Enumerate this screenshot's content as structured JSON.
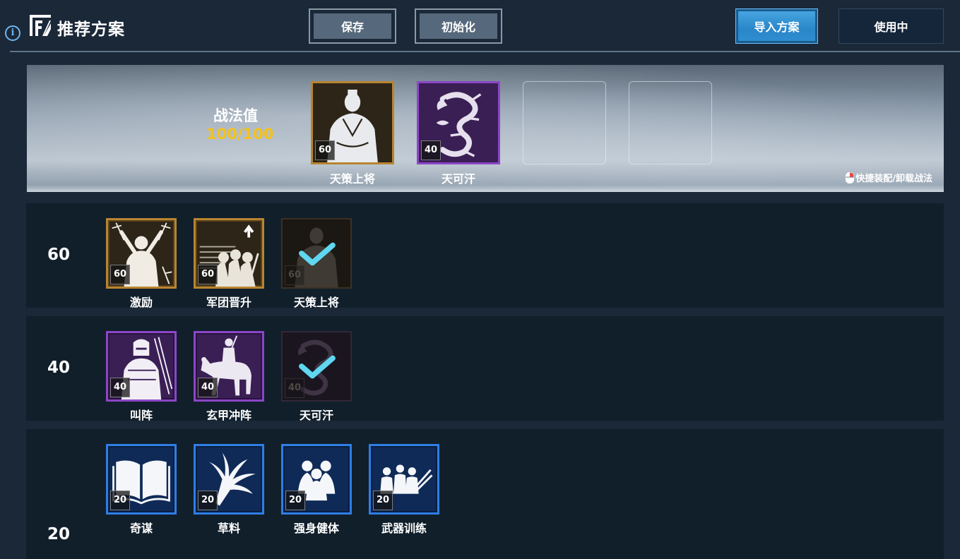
{
  "header": {
    "title": "推荐方案",
    "save_label": "保存",
    "reset_label": "初始化",
    "import_label": "导入方案",
    "in_use_label": "使用中"
  },
  "banner": {
    "points_label": "战法值",
    "points_value": "100/100",
    "equipped": [
      {
        "name": "天策上将",
        "level": "60",
        "tier": "gold"
      },
      {
        "name": "天可汗",
        "level": "40",
        "tier": "purple"
      }
    ],
    "empty_slots": 2,
    "hint": "快捷装配/卸载战法"
  },
  "rows": [
    {
      "level": "60",
      "cards": [
        {
          "name": "激励",
          "badge": "60",
          "tier": "gold",
          "icon": "rallying-warrior-icon",
          "selected": false
        },
        {
          "name": "军团晋升",
          "badge": "60",
          "tier": "gold",
          "icon": "legion-promotion-icon",
          "selected": false
        },
        {
          "name": "天策上将",
          "badge": "60",
          "tier": "gold",
          "icon": "general-portrait-icon",
          "selected": true
        }
      ]
    },
    {
      "level": "40",
      "cards": [
        {
          "name": "叫阵",
          "badge": "40",
          "tier": "purple",
          "icon": "challenger-warrior-icon",
          "selected": false
        },
        {
          "name": "玄甲冲阵",
          "badge": "40",
          "tier": "purple",
          "icon": "armored-cavalry-icon",
          "selected": false
        },
        {
          "name": "天可汗",
          "badge": "40",
          "tier": "purple",
          "icon": "dragon-icon",
          "selected": true
        }
      ]
    },
    {
      "level": "20",
      "cards": [
        {
          "name": "奇谋",
          "badge": "20",
          "tier": "blue",
          "icon": "open-book-icon",
          "selected": false
        },
        {
          "name": "草料",
          "badge": "20",
          "tier": "blue",
          "icon": "fodder-sheaf-icon",
          "selected": false
        },
        {
          "name": "强身健体",
          "badge": "20",
          "tier": "blue",
          "icon": "soldiers-fitness-icon",
          "selected": false
        },
        {
          "name": "武器训练",
          "badge": "20",
          "tier": "blue",
          "icon": "weapon-training-icon",
          "selected": false
        }
      ]
    }
  ],
  "colors": {
    "background": "#1b2838",
    "row_bg": "#111f2b",
    "gold_frame": "#b88530",
    "purple_frame": "#8b46c6",
    "blue_frame": "#2e7ee6",
    "points_value": "#f4c21a",
    "check": "#5fd7f0",
    "import_button": "#3597d8"
  }
}
